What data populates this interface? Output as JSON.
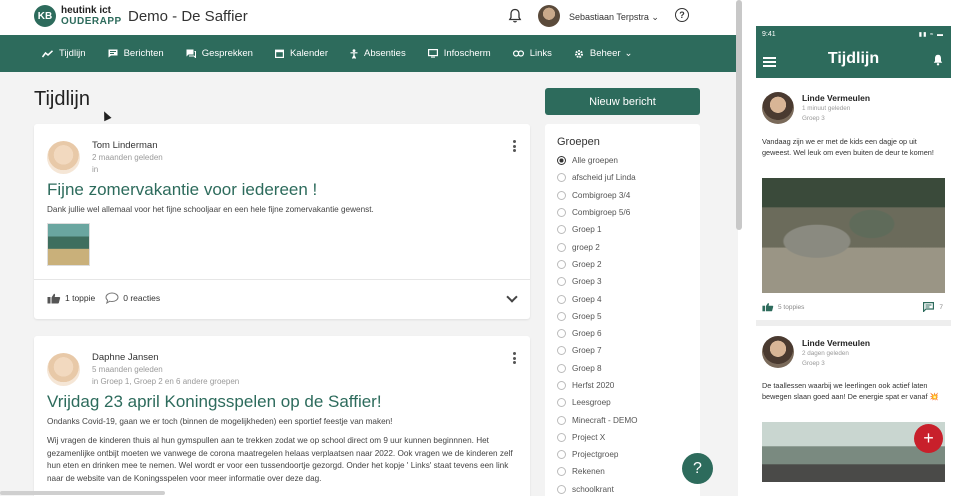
{
  "header": {
    "logo_mark": "KB",
    "logo_brand": "heutink ict",
    "logo_app": "OUDERAPP",
    "school_title": "Demo - De Saffier",
    "user_name": "Sebastiaan Terpstra",
    "help_glyph": "?"
  },
  "nav": {
    "items": [
      {
        "label": "Tijdlijn",
        "icon": "timeline-icon"
      },
      {
        "label": "Berichten",
        "icon": "message-icon"
      },
      {
        "label": "Gesprekken",
        "icon": "chat-icon"
      },
      {
        "label": "Kalender",
        "icon": "calendar-icon"
      },
      {
        "label": "Absenties",
        "icon": "person-icon"
      },
      {
        "label": "Infoscherm",
        "icon": "monitor-icon"
      },
      {
        "label": "Links",
        "icon": "link-icon"
      },
      {
        "label": "Beheer",
        "icon": "gear-icon"
      }
    ]
  },
  "main": {
    "page_title": "Tijdlijn",
    "new_post_label": "Nieuw bericht",
    "posts": [
      {
        "author": "Tom Linderman",
        "time": "2 maanden geleden",
        "audience": "in",
        "title": "Fijne zomervakantie voor iedereen !",
        "body": "Dank jullie wel allemaal voor het fijne schooljaar en een hele fijne zomervakantie gewenst.",
        "likes": "1 toppie",
        "comments": "0 reacties"
      },
      {
        "author": "Daphne Jansen",
        "time": "5 maanden geleden",
        "audience": "in Groep 1, Groep 2 en 6 andere groepen",
        "title": "Vrijdag 23 april Koningsspelen op de Saffier!",
        "body_1": "Ondanks Covid-19, gaan we er toch (binnen de mogelijkheden) een sportief feestje van maken!",
        "body_2": "Wij vragen de kinderen thuis al hun gymspullen aan te trekken zodat we op school direct om 9 uur kunnen beginnnen. Het gezamenlijke ontbijt moeten we vanwege de corona maatregelen helaas verplaatsen naar 2022. Ook vragen we de kinderen zelf hun eten en drinken mee te nemen. Wel wordt er voor een tussendoortje gezorgd. Onder het kopje ' Links' staat tevens een link naar de website van de Koningsspelen voor meer informatie over deze dag."
      }
    ]
  },
  "groups": {
    "title": "Groepen",
    "selected": "Alle groepen",
    "items": [
      "Alle groepen",
      "afscheid juf Linda",
      "Combigroep 3/4",
      "Combigroep 5/6",
      "Groep 1",
      "groep 2",
      "Groep 2",
      "Groep 3",
      "Groep 4",
      "Groep 5",
      "Groep 6",
      "Groep 7",
      "Groep 8",
      "Herfst 2020",
      "Leesgroep",
      "Minecraft - DEMO",
      "Project X",
      "Projectgroep",
      "Rekenen",
      "schoolkrant"
    ]
  },
  "help_fab": "?",
  "phone": {
    "time": "9:41",
    "status": "▮▮ ≈ ▬",
    "title": "Tijdlijn",
    "posts": [
      {
        "author": "Linde Vermeulen",
        "time": "1 minuut geleden",
        "group": "Groep 3",
        "text": "Vandaag zijn we er met de kids een dagje op uit geweest. Wel leuk om even buiten de deur te komen!",
        "likes": "5 toppies",
        "comments": "7"
      },
      {
        "author": "Linde Vermeulen",
        "time": "2 dagen geleden",
        "group": "Groep 3",
        "text": "De taallessen waarbij we leerlingen ook actief laten bewegen slaan goed aan! De energie spat er vanaf 💥"
      }
    ],
    "fab_glyph": "+"
  },
  "colors": {
    "brand": "#2d6b5c",
    "fab_red": "#c8202b"
  }
}
